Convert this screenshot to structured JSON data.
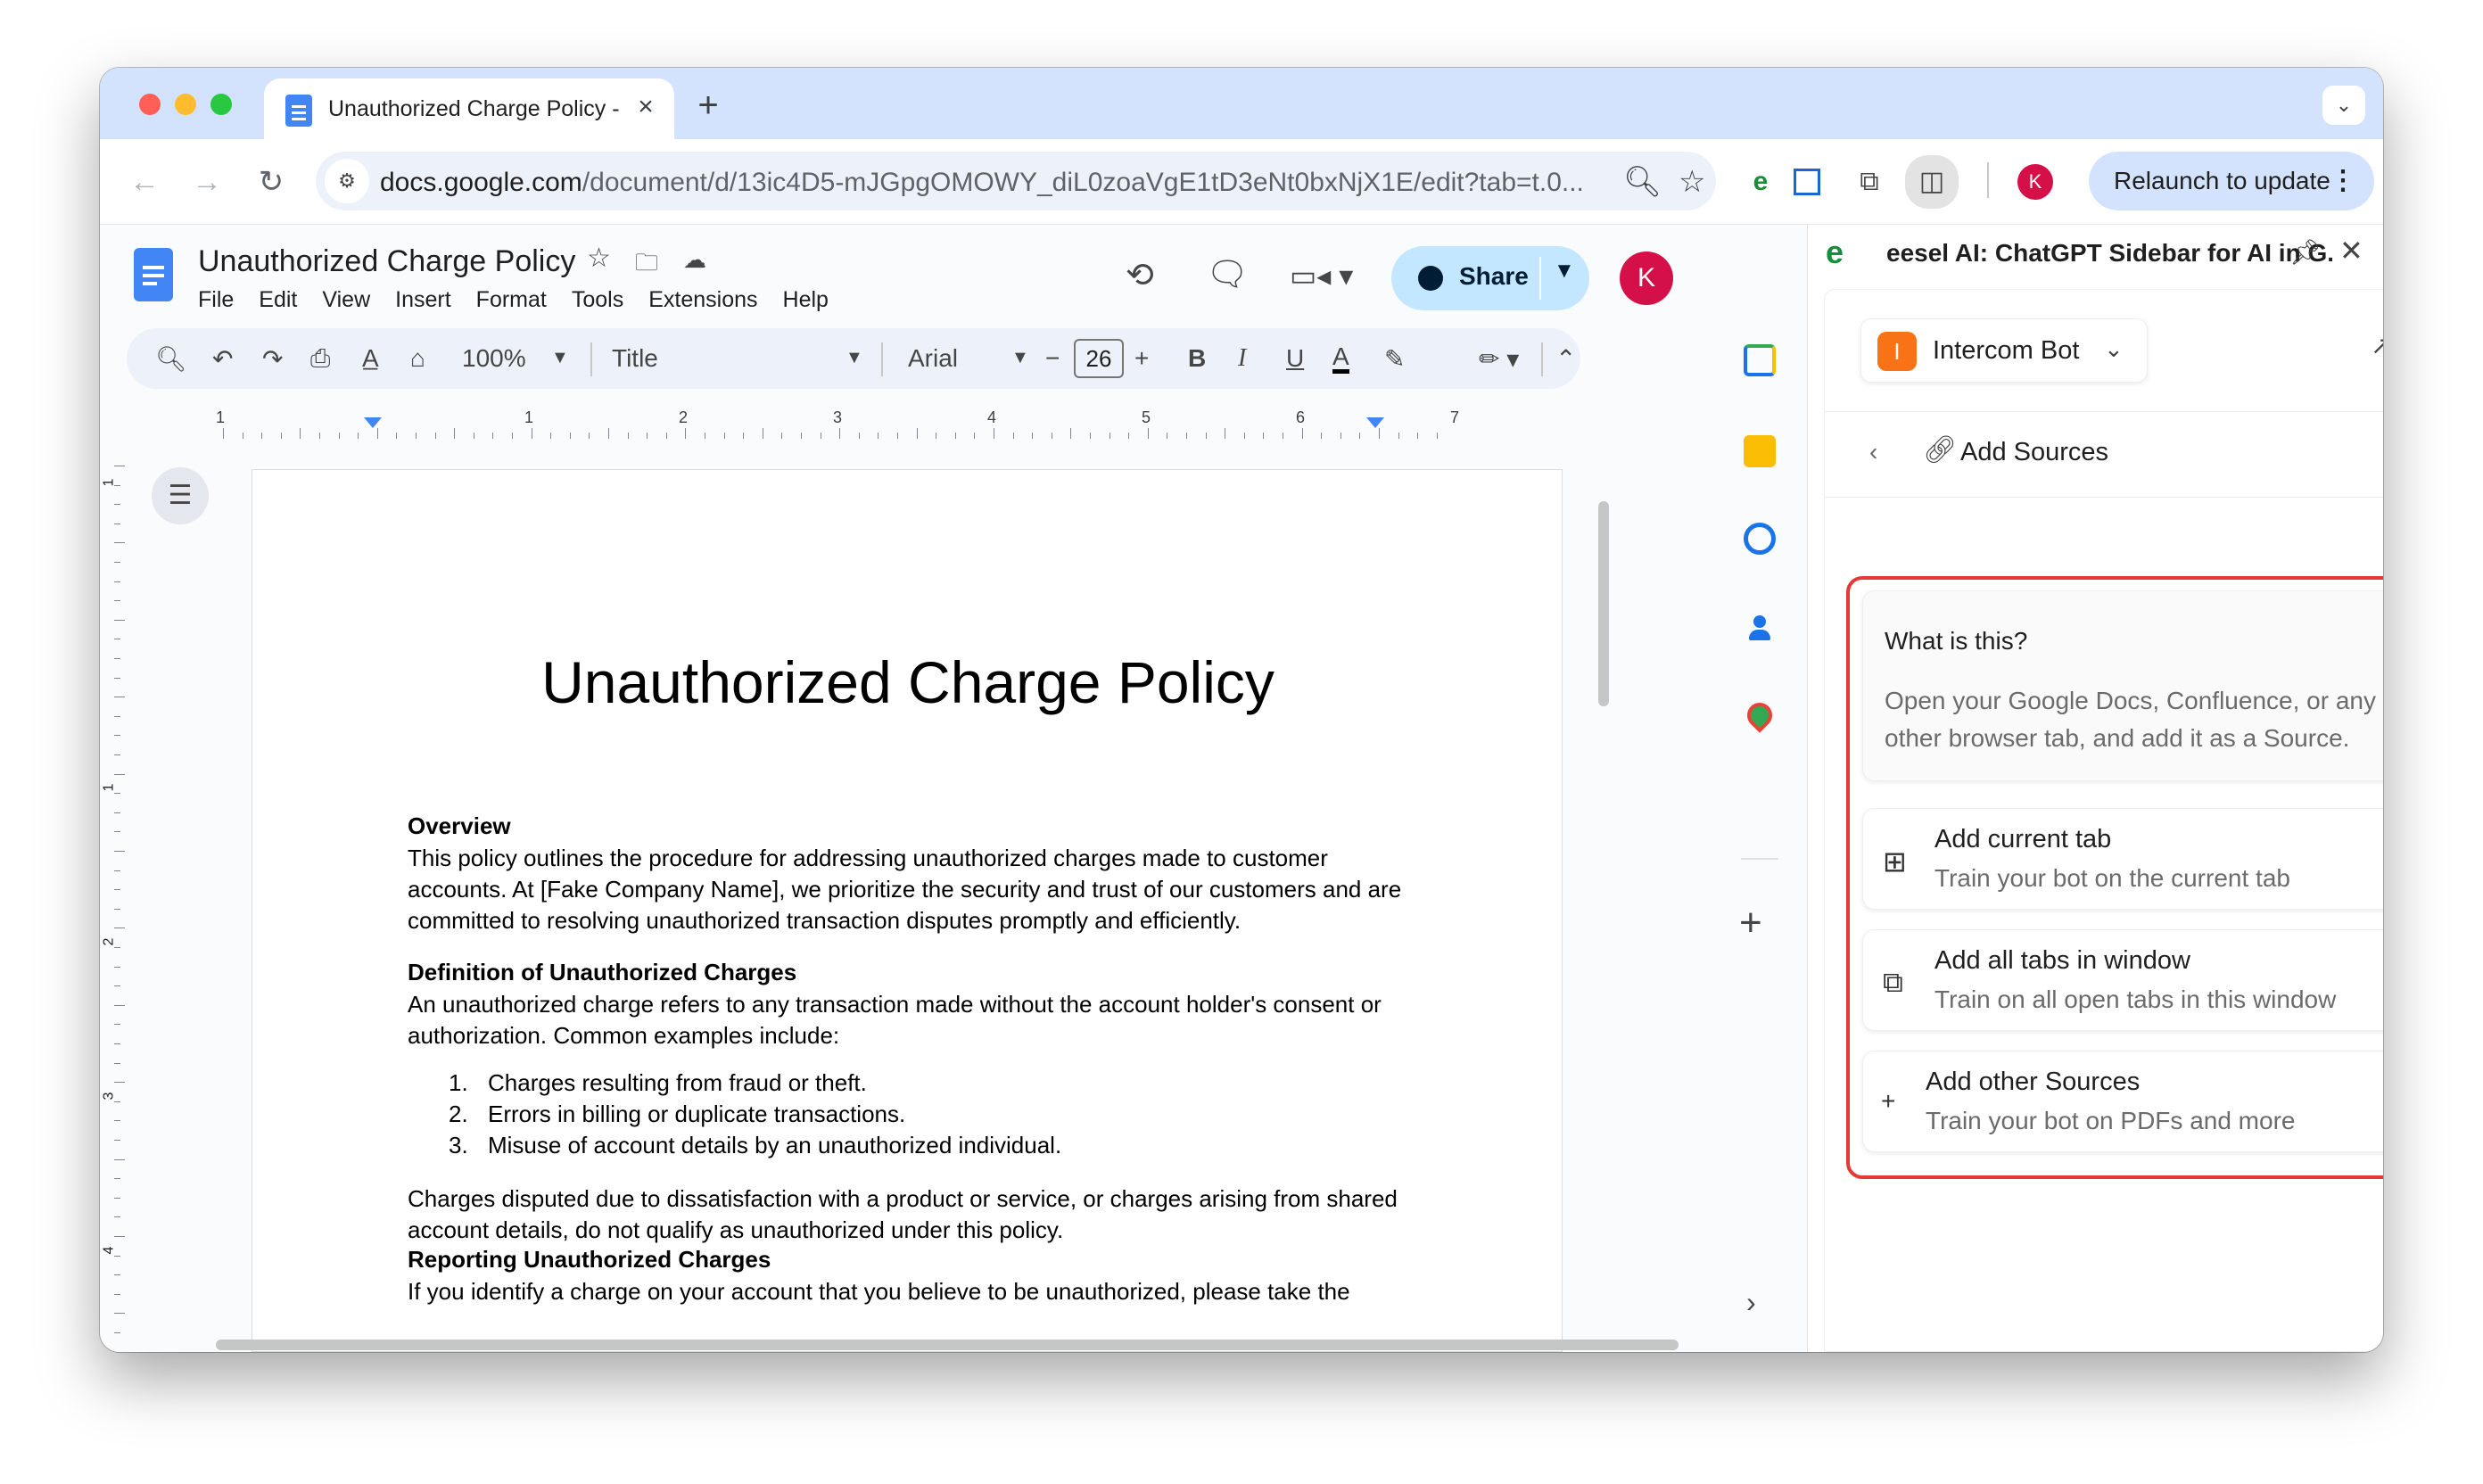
{
  "browser": {
    "tab_title": "Unauthorized Charge Policy -",
    "new_tab_symbol": "+",
    "url_host": "docs.google.com",
    "url_path": "/document/d/13ic4D5-mJGpgOMOWY_diL0zoaVgE1tD3eNt0bxNjX1E/edit?tab=t.0...",
    "relaunch_label": "Relaunch to update",
    "profile_initial": "K"
  },
  "docs": {
    "title": "Unauthorized Charge Policy",
    "menu": [
      "File",
      "Edit",
      "View",
      "Insert",
      "Format",
      "Tools",
      "Extensions",
      "Help"
    ],
    "share_label": "Share",
    "avatar_initial": "K",
    "format_bar": {
      "zoom": "100%",
      "style": "Title",
      "font": "Arial",
      "font_size": "26"
    },
    "ruler_numbers": [
      "1",
      "1",
      "2",
      "3",
      "4",
      "5",
      "6",
      "7"
    ],
    "vruler_numbers": [
      "1",
      "1",
      "2",
      "3",
      "4"
    ]
  },
  "document": {
    "heading": "Unauthorized Charge Policy",
    "overview_heading": "Overview",
    "overview_body": "This policy outlines the procedure for addressing unauthorized charges made to customer accounts. At [Fake Company Name], we prioritize the security and trust of our customers and are committed to resolving unauthorized transaction disputes promptly and efficiently.",
    "definition_heading": "Definition of Unauthorized Charges",
    "definition_body": "An unauthorized charge refers to any transaction made without the account holder's consent or authorization. Common examples include:",
    "list": [
      {
        "n": "1.",
        "text": "Charges resulting from fraud or theft."
      },
      {
        "n": "2.",
        "text": "Errors in billing or duplicate transactions."
      },
      {
        "n": "3.",
        "text": "Misuse of account details by an unauthorized individual."
      }
    ],
    "dissatisfaction_body": "Charges disputed due to dissatisfaction with a product or service, or charges arising from shared account details, do not qualify as unauthorized under this policy.",
    "reporting_heading": "Reporting Unauthorized Charges",
    "reporting_body": "If you identify a charge on your account that you believe to be unauthorized, please take the"
  },
  "side_panel": {
    "title": "eesel AI: ChatGPT Sidebar for AI in G...",
    "bot_initial": "I",
    "bot_name": "Intercom Bot",
    "section_title": "Add Sources",
    "info_title": "What is this?",
    "info_body": "Open your Google Docs, Confluence, or any other browser tab, and add it as a Source.",
    "options": [
      {
        "title": "Add current tab",
        "subtitle": "Train your bot on the current tab"
      },
      {
        "title": "Add all tabs in window",
        "subtitle": "Train on all open tabs in this window"
      },
      {
        "title": "Add other Sources",
        "subtitle": "Train your bot on PDFs and more"
      }
    ]
  },
  "colors": {
    "tabstrip": "#d3e3fd",
    "share_button": "#c2e7ff",
    "avatar": "#d50f47",
    "highlight": "#e53935",
    "bot_avatar": "#f97316"
  }
}
